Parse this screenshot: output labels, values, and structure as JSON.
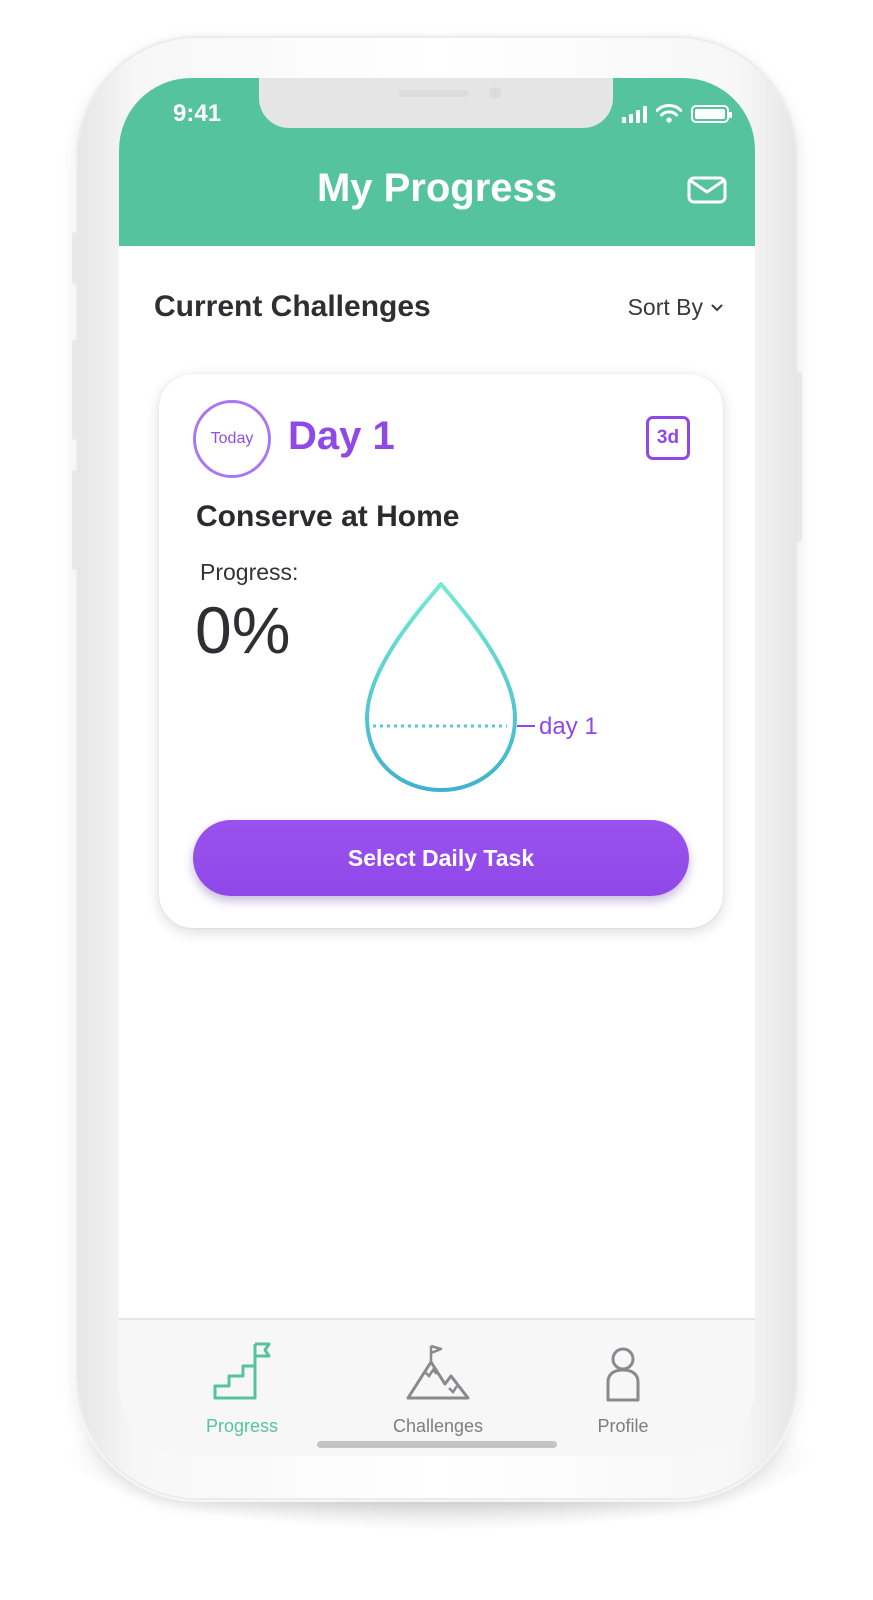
{
  "status_bar": {
    "time": "9:41"
  },
  "header": {
    "title": "My Progress",
    "icon": "mail-icon"
  },
  "section": {
    "title": "Current Challenges",
    "sort_label": "Sort By"
  },
  "challenge_card": {
    "badge": "Today",
    "day": "Day 1",
    "duration": "3d",
    "name": "Conserve at Home",
    "progress_label": "Progress:",
    "progress_value": "0%",
    "progress_fraction": 0,
    "marker_label": "day 1",
    "button_label": "Select Daily Task"
  },
  "nav": {
    "items": [
      {
        "label": "Progress",
        "icon": "stairs-flag-icon",
        "active": true
      },
      {
        "label": "Challenges",
        "icon": "mountain-flag-icon",
        "active": false
      },
      {
        "label": "Profile",
        "icon": "person-icon",
        "active": false
      }
    ]
  },
  "colors": {
    "header": "#56c39f",
    "accent_purple": "#9048e6",
    "drop_gradient_top": "#72e8cf",
    "drop_gradient_bottom": "#42b4cf"
  }
}
